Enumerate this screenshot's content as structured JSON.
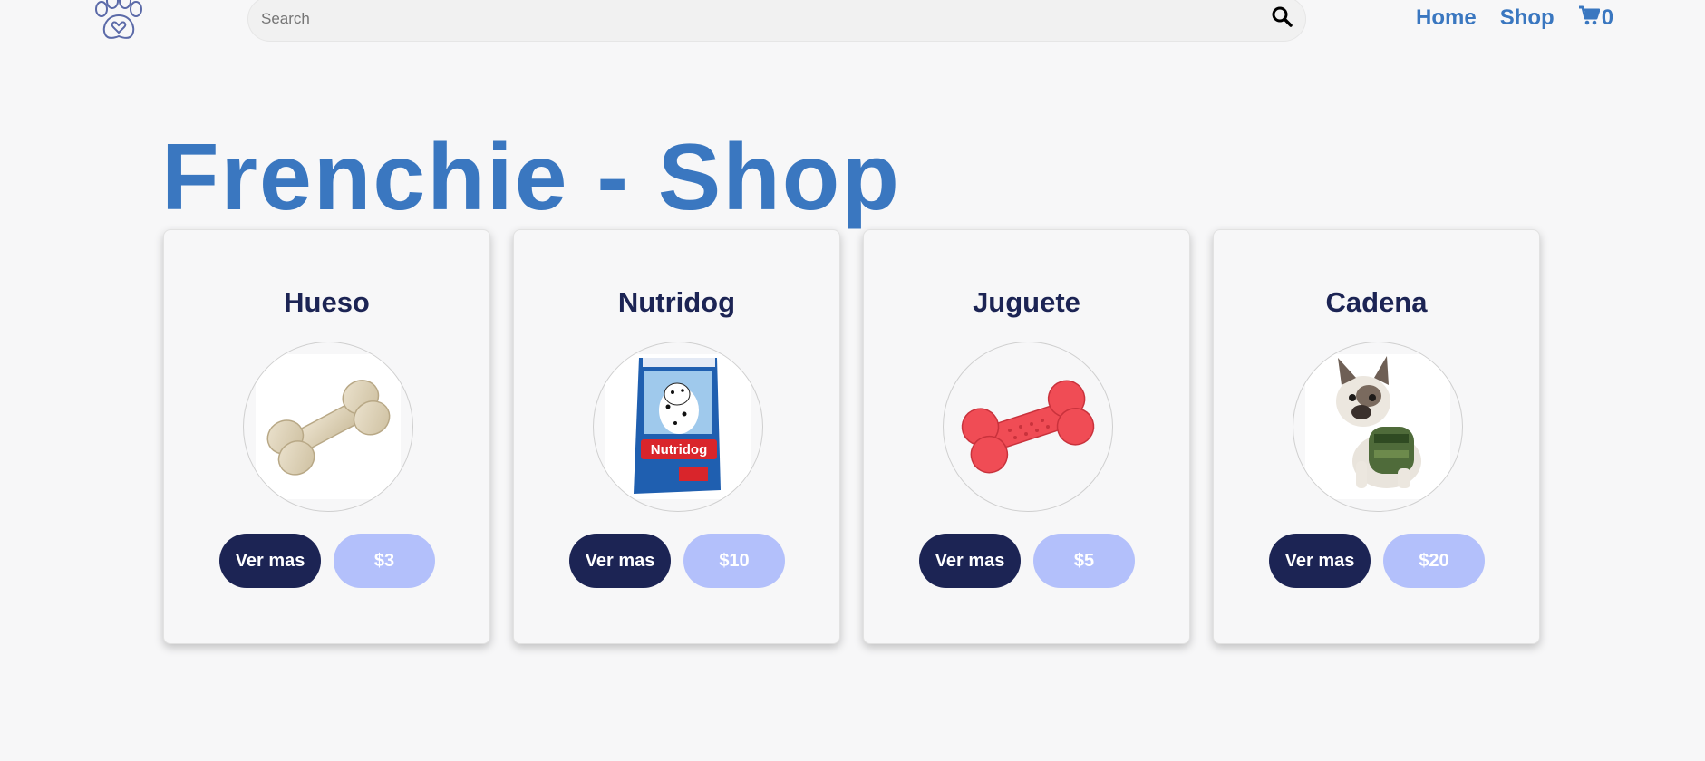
{
  "nav": {
    "logo_icon": "paw-heart-logo",
    "search": {
      "placeholder": "Search",
      "value": "",
      "icon": "search-icon"
    },
    "links": [
      {
        "label": "Home"
      },
      {
        "label": "Shop"
      }
    ],
    "cart": {
      "icon": "cart-icon",
      "count": "0"
    }
  },
  "hero": {
    "title": "Frenchie - Shop"
  },
  "products": [
    {
      "name": "Hueso",
      "image_icon": "bone-image",
      "more_label": "Ver mas",
      "price": "$3"
    },
    {
      "name": "Nutridog",
      "image_icon": "dog-food-bag-image",
      "more_label": "Ver mas",
      "price": "$10"
    },
    {
      "name": "Juguete",
      "image_icon": "bone-toy-image",
      "more_label": "Ver mas",
      "price": "$5"
    },
    {
      "name": "Cadena",
      "image_icon": "dog-harness-image",
      "more_label": "Ver mas",
      "price": "$20"
    }
  ],
  "colors": {
    "accent": "#3a77c0",
    "navy": "#1c2454",
    "price_pill": "#b3c0fb",
    "background": "#f7f7f8"
  }
}
